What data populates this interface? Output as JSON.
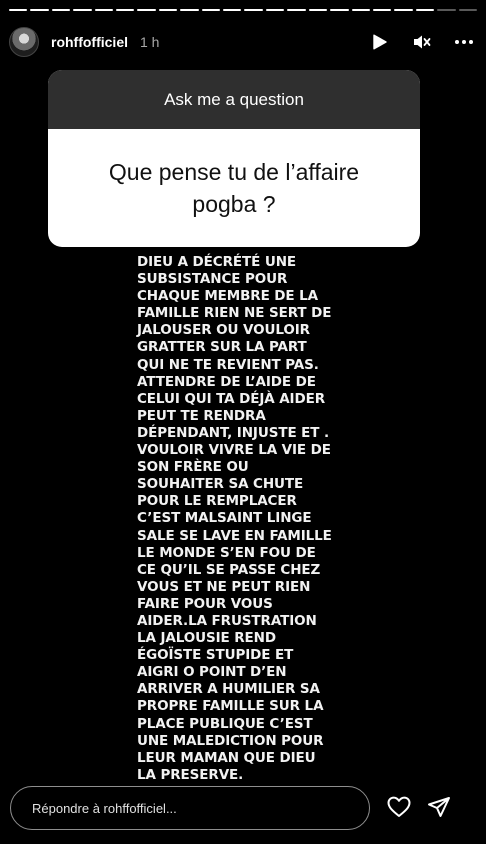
{
  "story": {
    "progress_segments": 22,
    "progress_completed": 20
  },
  "header": {
    "username": "rohffofficiel",
    "time": "1 h",
    "icons": [
      "play-icon",
      "mute-icon",
      "more-icon"
    ]
  },
  "question_card": {
    "title": "Ask me a question",
    "question": "Que pense tu de l’affaire pogba ?"
  },
  "story_text": "DIEU A DÉCRÉTÉ UNE SUBSISTANCE POUR CHAQUE MEMBRE DE LA FAMILLE RIEN NE SERT DE JALOUSER OU VOULOIR GRATTER SUR LA PART QUI NE TE REVIENT PAS. ATTENDRE DE L’AIDE DE CELUI QUI TA DÉJÀ AIDER PEUT TE RENDRA DÉPENDANT, INJUSTE ET . VOULOIR VIVRE LA VIE DE SON FRÈRE OU SOUHAITER SA CHUTE POUR LE REMPLACER C’EST MALSAINT LINGE SALE SE LAVE EN FAMILLE LE MONDE S’EN FOU DE CE QU’IL SE PASSE CHEZ VOUS ET NE PEUT RIEN FAIRE POUR VOUS AIDER.LA FRUSTRATION LA JALOUSIE REND ÉGOÏSTE STUPIDE ET AIGRI O POINT D’EN ARRIVER A HUMILIER SA PROPRE FAMILLE SUR LA PLACE PUBLIQUE C’EST UNE MALEDICTION POUR LEUR MAMAN QUE DIEU LA PRESERVE.",
  "reply": {
    "placeholder": "Répondre à rohffofficiel...",
    "icons": [
      "heart-icon",
      "send-icon"
    ]
  }
}
